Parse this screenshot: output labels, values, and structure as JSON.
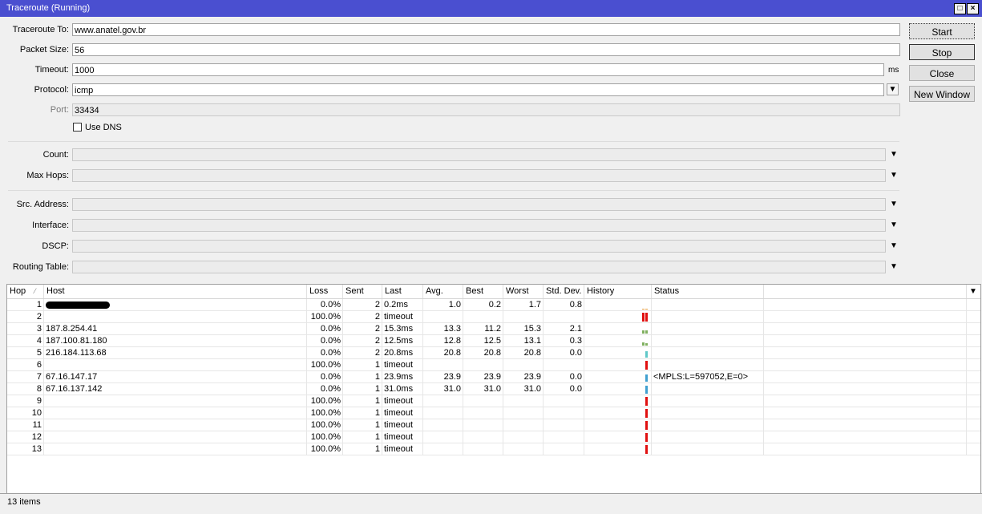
{
  "window": {
    "title": "Traceroute (Running)"
  },
  "form": {
    "traceroute_to": {
      "label": "Traceroute To:",
      "value": "www.anatel.gov.br"
    },
    "packet_size": {
      "label": "Packet Size:",
      "value": "56"
    },
    "timeout": {
      "label": "Timeout:",
      "value": "1000",
      "unit": "ms"
    },
    "protocol": {
      "label": "Protocol:",
      "value": "icmp"
    },
    "port": {
      "label": "Port:",
      "value": "33434"
    },
    "use_dns": {
      "label": "Use DNS",
      "checked": false
    },
    "count": {
      "label": "Count:",
      "value": ""
    },
    "max_hops": {
      "label": "Max Hops:",
      "value": ""
    },
    "src_address": {
      "label": "Src. Address:",
      "value": ""
    },
    "interface": {
      "label": "Interface:",
      "value": ""
    },
    "dscp": {
      "label": "DSCP:",
      "value": ""
    },
    "routing_table": {
      "label": "Routing Table:",
      "value": ""
    }
  },
  "buttons": {
    "start": "Start",
    "stop": "Stop",
    "close": "Close",
    "new_window": "New Window"
  },
  "table": {
    "columns": [
      "Hop",
      "Host",
      "Loss",
      "Sent",
      "Last",
      "Avg.",
      "Best",
      "Worst",
      "Std. Dev.",
      "History",
      "Status"
    ],
    "rows": [
      {
        "hop": "1",
        "host": "",
        "loss": "0.0%",
        "sent": "2",
        "last": "0.2ms",
        "avg": "1.0",
        "best": "0.2",
        "worst": "1.7",
        "std": "0.8",
        "status": "",
        "history": [
          "#e8a040",
          "#e8a040"
        ],
        "hist_h": [
          1,
          1
        ]
      },
      {
        "hop": "2",
        "host": "",
        "loss": "100.0%",
        "sent": "2",
        "last": "timeout",
        "avg": "",
        "best": "",
        "worst": "",
        "std": "",
        "status": "",
        "history": [
          "#e01010",
          "#e01010"
        ],
        "hist_h": [
          11,
          11
        ]
      },
      {
        "hop": "3",
        "host": "187.8.254.41",
        "loss": "0.0%",
        "sent": "2",
        "last": "15.3ms",
        "avg": "13.3",
        "best": "11.2",
        "worst": "15.3",
        "std": "2.1",
        "status": "",
        "history": [
          "#80b060",
          "#80b060"
        ],
        "hist_h": [
          4,
          4
        ]
      },
      {
        "hop": "4",
        "host": "187.100.81.180",
        "loss": "0.0%",
        "sent": "2",
        "last": "12.5ms",
        "avg": "12.8",
        "best": "12.5",
        "worst": "13.1",
        "std": "0.3",
        "status": "",
        "history": [
          "#80b060",
          "#80b060"
        ],
        "hist_h": [
          4,
          3
        ]
      },
      {
        "hop": "5",
        "host": "216.184.113.68",
        "loss": "0.0%",
        "sent": "2",
        "last": "20.8ms",
        "avg": "20.8",
        "best": "20.8",
        "worst": "20.8",
        "std": "0.0",
        "status": "",
        "history": [
          "#60c8c8"
        ],
        "hist_h": [
          8
        ]
      },
      {
        "hop": "6",
        "host": "",
        "loss": "100.0%",
        "sent": "1",
        "last": "timeout",
        "avg": "",
        "best": "",
        "worst": "",
        "std": "",
        "status": "",
        "history": [
          "#e01010"
        ],
        "hist_h": [
          11
        ]
      },
      {
        "hop": "7",
        "host": "67.16.147.17",
        "loss": "0.0%",
        "sent": "1",
        "last": "23.9ms",
        "avg": "23.9",
        "best": "23.9",
        "worst": "23.9",
        "std": "0.0",
        "status": "<MPLS:L=597052,E=0>",
        "history": [
          "#40a0d0"
        ],
        "hist_h": [
          9
        ]
      },
      {
        "hop": "8",
        "host": "67.16.137.142",
        "loss": "0.0%",
        "sent": "1",
        "last": "31.0ms",
        "avg": "31.0",
        "best": "31.0",
        "worst": "31.0",
        "std": "0.0",
        "status": "",
        "history": [
          "#40a0d0"
        ],
        "hist_h": [
          10
        ]
      },
      {
        "hop": "9",
        "host": "",
        "loss": "100.0%",
        "sent": "1",
        "last": "timeout",
        "avg": "",
        "best": "",
        "worst": "",
        "std": "",
        "status": "",
        "history": [
          "#e01010"
        ],
        "hist_h": [
          11
        ]
      },
      {
        "hop": "10",
        "host": "",
        "loss": "100.0%",
        "sent": "1",
        "last": "timeout",
        "avg": "",
        "best": "",
        "worst": "",
        "std": "",
        "status": "",
        "history": [
          "#e01010"
        ],
        "hist_h": [
          11
        ]
      },
      {
        "hop": "11",
        "host": "",
        "loss": "100.0%",
        "sent": "1",
        "last": "timeout",
        "avg": "",
        "best": "",
        "worst": "",
        "std": "",
        "status": "",
        "history": [
          "#e01010"
        ],
        "hist_h": [
          11
        ]
      },
      {
        "hop": "12",
        "host": "",
        "loss": "100.0%",
        "sent": "1",
        "last": "timeout",
        "avg": "",
        "best": "",
        "worst": "",
        "std": "",
        "status": "",
        "history": [
          "#e01010"
        ],
        "hist_h": [
          11
        ]
      },
      {
        "hop": "13",
        "host": "",
        "loss": "100.0%",
        "sent": "1",
        "last": "timeout",
        "avg": "",
        "best": "",
        "worst": "",
        "std": "",
        "status": "",
        "history": [
          "#e01010"
        ],
        "hist_h": [
          11
        ]
      }
    ]
  },
  "statusbar": {
    "count": "13 items"
  }
}
